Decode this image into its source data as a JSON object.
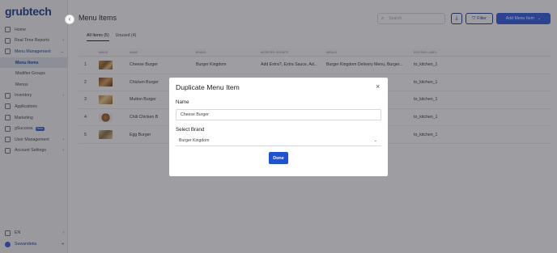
{
  "app": {
    "logo": "grubtech"
  },
  "sidebar": {
    "items": [
      {
        "label": "Home",
        "icon": "home-icon"
      },
      {
        "label": "Real Time Reports",
        "icon": "chart-icon",
        "chevron": "›"
      },
      {
        "label": "Menu Management",
        "icon": "book-icon",
        "chevron": "⌄"
      },
      {
        "label": "Menu Items"
      },
      {
        "label": "Modifier Groups"
      },
      {
        "label": "Menus"
      },
      {
        "label": "Inventory",
        "icon": "box-icon",
        "chevron": "›"
      },
      {
        "label": "Applications",
        "icon": "monitor-icon"
      },
      {
        "label": "Marketing",
        "icon": "megaphone-icon"
      },
      {
        "label": "gSuccess",
        "badge": "New",
        "icon": "star-icon"
      },
      {
        "label": "User Management",
        "icon": "users-icon",
        "chevron": "›"
      },
      {
        "label": "Account Settings",
        "icon": "gear-icon",
        "chevron": "›"
      }
    ],
    "footer": {
      "language": "EN",
      "language_chevron": "›",
      "user": "Suwandeka",
      "logout_icon": "⇥"
    }
  },
  "header": {
    "title": "Menu Items",
    "search_placeholder": "Search",
    "filter_label": "Filter",
    "add_label": "Add Menu Item"
  },
  "tabs": [
    {
      "label": "All Items (5)"
    },
    {
      "label": "Unused (4)"
    }
  ],
  "table": {
    "headers": [
      "",
      "IMAGE",
      "NAME",
      "BRAND",
      "MODIFIER GROUPS",
      "MENUS",
      "ROUTING LABEL"
    ],
    "rows": [
      {
        "num": "1",
        "name": "Cheese Burger",
        "brand": "Burger Kingdom",
        "modifiers": "Add Extra?, Extra Sauce, Ad...",
        "menus": "Burger Kingdom Delivery Menu, Burger...",
        "routing": "to_kitchen_1"
      },
      {
        "num": "2",
        "name": "Chicken Burger",
        "brand": "",
        "modifiers": "",
        "menus": "",
        "routing": "to_kitchen_1"
      },
      {
        "num": "3",
        "name": "Mutton Burger",
        "brand": "",
        "modifiers": "",
        "menus": "",
        "routing": "to_kitchen_1"
      },
      {
        "num": "4",
        "name": "Chili Chicken B",
        "brand": "",
        "modifiers": "",
        "menus": "",
        "routing": "to_kitchen_1"
      },
      {
        "num": "5",
        "name": "Egg Burger",
        "brand": "",
        "modifiers": "",
        "menus": "",
        "routing": "to_kitchen_1"
      }
    ]
  },
  "modal": {
    "title": "Duplicate Menu Item",
    "close": "×",
    "name_label": "Name",
    "name_value": "Cheese Burger",
    "brand_label": "Select Brand",
    "brand_value": "Burger Kingdom",
    "done_label": "Done"
  },
  "colors": {
    "primary": "#2d5be3",
    "brand": "#1c3c8e",
    "overlay": "#282830"
  }
}
